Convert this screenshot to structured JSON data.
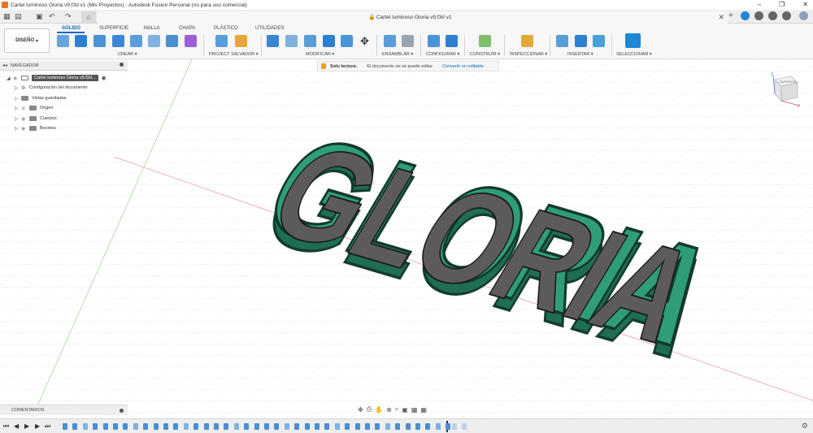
{
  "window": {
    "title": "Cartel luminoso Gloria v9.f3d v1 (Mis Proyectos) - Autodesk Fusion Personal (no para uso comercial)",
    "min": "–",
    "max": "❐",
    "close": "✕"
  },
  "quickaccess": {
    "grid_icon": "▦",
    "file_icon": "▤",
    "save_icon": "▣",
    "undo_icon": "↶",
    "redo_icon": "↷",
    "home_icon": "⌂",
    "doc_tab_title": "Cartel luminoso Gloria v9.f3d v1",
    "lock_icon": "🔒",
    "close_tab": "✕",
    "new_tab": "+",
    "user_icon": "👤"
  },
  "ribbon": {
    "workspace": "DISEÑO",
    "tabs": [
      "SÓLIDO",
      "SUPERFICIE",
      "MALLA",
      "CHAPA",
      "PLÁSTICO",
      "UTILIDADES"
    ],
    "groups": [
      "CREAR",
      "PROJECT SALVADOR",
      "MODIFICAR",
      "ENSAMBLAR",
      "CONFIGURAR",
      "CONSTRUIR",
      "INSPECCIONAR",
      "INSERTAR",
      "SELECCIONAR"
    ]
  },
  "navigator": {
    "title": "NAVEGADOR",
    "root": "Cartel luminoso Gloria v9.f3d...",
    "items": [
      "Configuración del documento",
      "Vistas guardadas",
      "Origen",
      "Cuerpos",
      "Bocetos"
    ]
  },
  "readonly": {
    "label": "Solo lectura:",
    "message": "El documento no se puede editar",
    "link": "Convertir en editable"
  },
  "viewcube": {
    "face": "SUPERIOR",
    "axis_x": "X",
    "axis_z": "Z"
  },
  "model": {
    "text": "GLORIA",
    "color": "#2f9e78",
    "inner_color": "#5d5b5a"
  },
  "comments": {
    "title": "COMENTARIOS"
  },
  "navbar": {
    "icons": [
      "✥",
      "⎙",
      "✋",
      "⊕",
      "⌕",
      "▣",
      "▦",
      "▦"
    ]
  },
  "timeline": {
    "first": "⏮",
    "prev": "◀",
    "play": "▶",
    "next": "▶",
    "last": "⏭",
    "settings": "⚙"
  },
  "colors": {
    "accent": "#0a68c2",
    "grid": "#e4e4e4",
    "x_axis": "#e08080",
    "y_axis": "#80c080"
  }
}
